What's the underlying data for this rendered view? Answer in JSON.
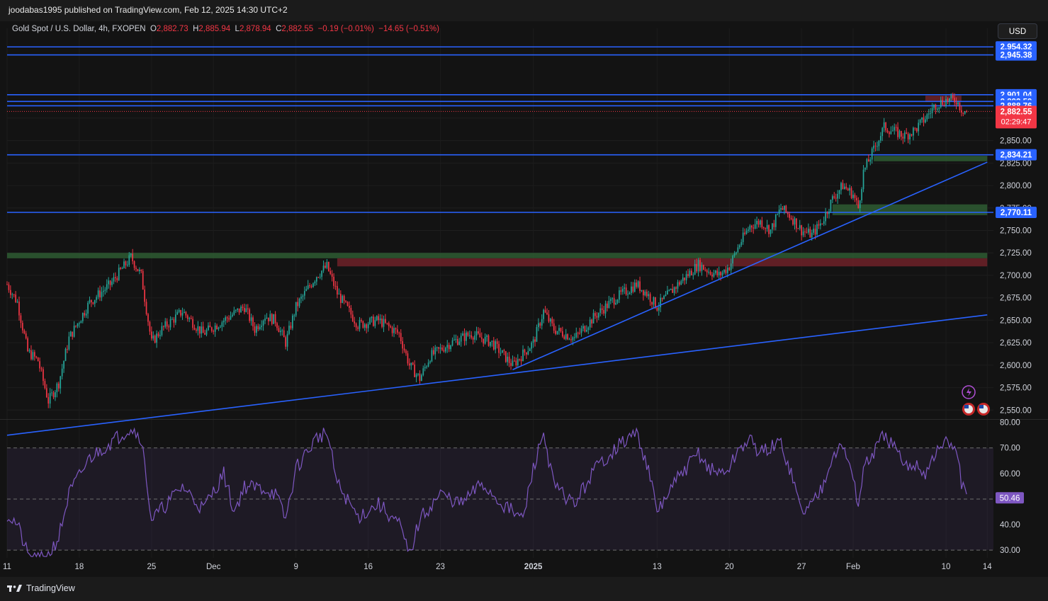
{
  "header": {
    "publisher_line": "joodabas1995 published on TradingView.com, Feb 12, 2025 14:30 UTC+2"
  },
  "legend": {
    "symbol": "Gold Spot / U.S. Dollar, 4h, FXOPEN",
    "o_label": "O",
    "o_value": "2,882.73",
    "h_label": "H",
    "h_value": "2,885.94",
    "l_label": "L",
    "l_value": "2,878.94",
    "c_label": "C",
    "c_value": "2,882.55",
    "change": "−0.19 (−0.01%)",
    "change2": "−14.65 (−0.51%)"
  },
  "currency_button": "USD",
  "brand": "TradingView",
  "colors": {
    "up": "#26a69a",
    "down": "#f23645",
    "hline": "#2962ff",
    "rsi": "#7e57c2",
    "demand_zone": "#2e5c33",
    "supply_zone": "#6e2229"
  },
  "chart_data": [
    {
      "type": "candlestick",
      "title": "",
      "interval": "4h",
      "yaxis": {
        "range": [
          2540,
          2975
        ],
        "ticks": [
          "2,550.00",
          "2,575.00",
          "2,600.00",
          "2,625.00",
          "2,650.00",
          "2,675.00",
          "2,700.00",
          "2,725.00",
          "2,750.00",
          "2,775.00",
          "2,800.00",
          "2,825.00",
          "2,850.00",
          "2,875.00"
        ],
        "tick_values": [
          2550,
          2575,
          2600,
          2625,
          2650,
          2675,
          2700,
          2725,
          2750,
          2775,
          2800,
          2825,
          2850,
          2875
        ]
      },
      "xaxis": {
        "labels": [
          "11",
          "18",
          "25",
          "Dec",
          "9",
          "16",
          "23",
          "2025",
          "13",
          "20",
          "27",
          "Feb",
          "10",
          "14"
        ],
        "label_days": [
          0,
          7,
          14,
          20,
          28,
          35,
          42,
          51,
          63,
          70,
          77,
          82,
          91,
          95
        ]
      },
      "close_path": [
        [
          0,
          2690
        ],
        [
          1,
          2670
        ],
        [
          2,
          2615
        ],
        [
          3,
          2605
        ],
        [
          4,
          2560
        ],
        [
          5,
          2580
        ],
        [
          6,
          2630
        ],
        [
          8,
          2670
        ],
        [
          10,
          2690
        ],
        [
          12,
          2720
        ],
        [
          13,
          2700
        ],
        [
          14,
          2625
        ],
        [
          15,
          2640
        ],
        [
          17,
          2660
        ],
        [
          19,
          2635
        ],
        [
          21,
          2650
        ],
        [
          23,
          2665
        ],
        [
          24,
          2640
        ],
        [
          25,
          2655
        ],
        [
          26,
          2650
        ],
        [
          27,
          2625
        ],
        [
          28,
          2665
        ],
        [
          30,
          2700
        ],
        [
          31,
          2710
        ],
        [
          32,
          2680
        ],
        [
          34,
          2645
        ],
        [
          36,
          2650
        ],
        [
          38,
          2635
        ],
        [
          39,
          2600
        ],
        [
          40,
          2585
        ],
        [
          41,
          2610
        ],
        [
          43,
          2625
        ],
        [
          45,
          2635
        ],
        [
          47,
          2625
        ],
        [
          49,
          2600
        ],
        [
          51,
          2625
        ],
        [
          52,
          2660
        ],
        [
          53,
          2640
        ],
        [
          55,
          2630
        ],
        [
          57,
          2655
        ],
        [
          59,
          2675
        ],
        [
          61,
          2690
        ],
        [
          62,
          2680
        ],
        [
          63,
          2665
        ],
        [
          65,
          2690
        ],
        [
          67,
          2712
        ],
        [
          68,
          2705
        ],
        [
          69,
          2700
        ],
        [
          70,
          2710
        ],
        [
          71,
          2735
        ],
        [
          72,
          2755
        ],
        [
          73,
          2760
        ],
        [
          74,
          2750
        ],
        [
          75,
          2775
        ],
        [
          76,
          2765
        ],
        [
          77,
          2750
        ],
        [
          78,
          2745
        ],
        [
          79,
          2760
        ],
        [
          80,
          2785
        ],
        [
          81,
          2800
        ],
        [
          82,
          2790
        ],
        [
          82.5,
          2775
        ],
        [
          83,
          2815
        ],
        [
          84,
          2840
        ],
        [
          85,
          2865
        ],
        [
          86,
          2860
        ],
        [
          87,
          2855
        ],
        [
          88,
          2862
        ],
        [
          89,
          2875
        ],
        [
          90,
          2890
        ],
        [
          91,
          2895
        ],
        [
          92,
          2895
        ],
        [
          92.5,
          2885
        ],
        [
          93,
          2882.55
        ]
      ],
      "horizontal_levels": [
        {
          "value": 2954.32,
          "label": "2,954.32"
        },
        {
          "value": 2945.38,
          "label": "2,945.38"
        },
        {
          "value": 2901.04,
          "label": "2,901.04"
        },
        {
          "value": 2893.59,
          "label": "2,893.59"
        },
        {
          "value": 2888.76,
          "label": "2,888.76"
        },
        {
          "value": 2834.21,
          "label": "2,834.21"
        },
        {
          "value": 2770.11,
          "label": "2,770.11"
        }
      ],
      "current_price": {
        "value": 2882.55,
        "label": "2,882.55",
        "countdown": "02:29:47"
      },
      "trendlines": [
        {
          "from": [
            0,
            2522
          ],
          "to": [
            95,
            2656
          ]
        },
        {
          "from": [
            49,
            2595
          ],
          "to": [
            95,
            2826
          ]
        }
      ],
      "zones": [
        {
          "kind": "demand",
          "x_from": 0,
          "x_to": 95,
          "y_from": 2719,
          "y_to": 2725
        },
        {
          "kind": "supply",
          "x_from": 32,
          "x_to": 95,
          "y_from": 2710,
          "y_to": 2719
        },
        {
          "kind": "demand",
          "x_from": 80,
          "x_to": 95,
          "y_from": 2767,
          "y_to": 2779
        },
        {
          "kind": "demand",
          "x_from": 84,
          "x_to": 95,
          "y_from": 2827,
          "y_to": 2833
        },
        {
          "kind": "supply",
          "x_from": 89,
          "x_to": 92.5,
          "y_from": 2893,
          "y_to": 2900
        }
      ]
    },
    {
      "type": "line",
      "title": "",
      "yaxis": {
        "range": [
          27,
          81
        ],
        "ticks": [
          "30.00",
          "40.00",
          "50.00",
          "60.00",
          "70.00",
          "80.00"
        ],
        "tick_values": [
          30,
          40,
          50,
          60,
          70,
          80
        ],
        "bands": [
          30,
          50,
          70
        ]
      },
      "series": [
        {
          "values_by_day": [
            [
              0,
              44
            ],
            [
              1,
              40
            ],
            [
              2,
              28
            ],
            [
              3,
              26
            ],
            [
              4,
              28
            ],
            [
              5,
              35
            ],
            [
              6,
              52
            ],
            [
              8,
              66
            ],
            [
              10,
              72
            ],
            [
              12,
              78
            ],
            [
              13,
              74
            ],
            [
              14,
              42
            ],
            [
              15,
              46
            ],
            [
              17,
              55
            ],
            [
              19,
              46
            ],
            [
              21,
              60
            ],
            [
              22,
              45
            ],
            [
              23,
              55
            ],
            [
              25,
              54
            ],
            [
              26,
              52
            ],
            [
              27,
              42
            ],
            [
              28,
              62
            ],
            [
              30,
              74
            ],
            [
              31,
              76
            ],
            [
              32,
              56
            ],
            [
              34,
              43
            ],
            [
              36,
              48
            ],
            [
              38,
              40
            ],
            [
              39,
              28
            ],
            [
              40,
              42
            ],
            [
              42,
              52
            ],
            [
              44,
              48
            ],
            [
              46,
              56
            ],
            [
              48,
              48
            ],
            [
              50,
              42
            ],
            [
              51,
              62
            ],
            [
              52,
              76
            ],
            [
              53,
              55
            ],
            [
              55,
              48
            ],
            [
              57,
              62
            ],
            [
              59,
              70
            ],
            [
              61,
              76
            ],
            [
              62,
              64
            ],
            [
              63,
              45
            ],
            [
              65,
              58
            ],
            [
              67,
              68
            ],
            [
              68,
              62
            ],
            [
              69,
              60
            ],
            [
              70,
              62
            ],
            [
              71,
              70
            ],
            [
              72,
              73
            ],
            [
              73,
              68
            ],
            [
              74,
              70
            ],
            [
              75,
              72
            ],
            [
              76,
              60
            ],
            [
              77,
              45
            ],
            [
              78,
              48
            ],
            [
              79,
              55
            ],
            [
              80,
              68
            ],
            [
              81,
              70
            ],
            [
              82,
              60
            ],
            [
              82.5,
              46
            ],
            [
              83,
              62
            ],
            [
              84,
              68
            ],
            [
              85,
              75
            ],
            [
              86,
              70
            ],
            [
              87,
              62
            ],
            [
              88,
              64
            ],
            [
              89,
              60
            ],
            [
              90,
              68
            ],
            [
              91,
              72
            ],
            [
              92,
              70
            ],
            [
              92.5,
              56
            ],
            [
              93,
              50.46
            ]
          ]
        }
      ],
      "last_value": {
        "value": 50.46,
        "label": "50.46"
      }
    }
  ]
}
